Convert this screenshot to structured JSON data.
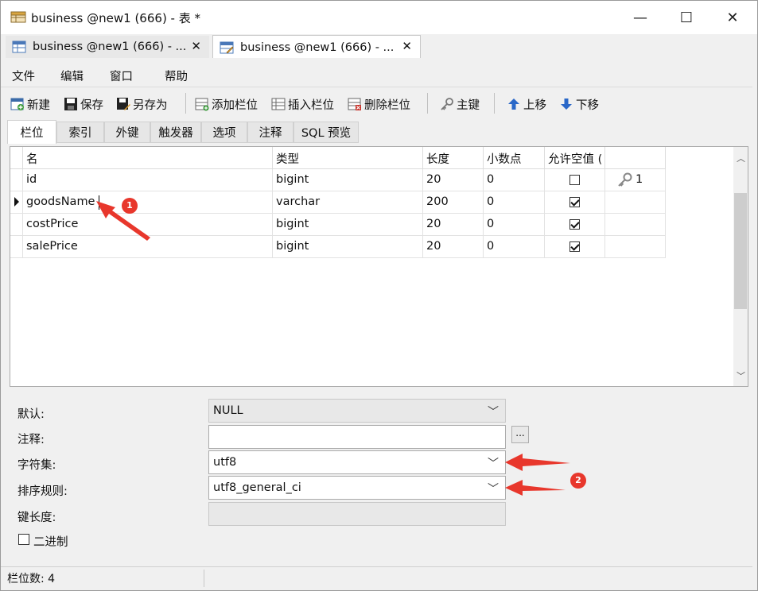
{
  "window": {
    "title": "business @new1 (666) - 表 *",
    "minimize_glyph": "—",
    "maximize_glyph": "☐",
    "close_glyph": "✕"
  },
  "doc_tabs": [
    {
      "label": "business @new1 (666) - ...",
      "close": "✕",
      "active": false
    },
    {
      "label": "business @new1 (666) - ...",
      "close": "✕",
      "active": true
    }
  ],
  "menu": [
    "文件",
    "编辑",
    "窗口",
    "帮助"
  ],
  "toolbar": {
    "new": "新建",
    "save": "保存",
    "save_as": "另存为",
    "add_field": "添加栏位",
    "insert_field": "插入栏位",
    "delete_field": "删除栏位",
    "primary_key": "主键",
    "move_up": "上移",
    "move_down": "下移"
  },
  "sub_tabs": [
    "栏位",
    "索引",
    "外键",
    "触发器",
    "选项",
    "注释",
    "SQL 预览"
  ],
  "grid": {
    "headers": [
      "名",
      "类型",
      "长度",
      "小数点",
      "允许空值 (",
      ""
    ],
    "rows": [
      {
        "name": "id",
        "type": "bigint",
        "length": "20",
        "decimal": "0",
        "nullable": false,
        "key": "1",
        "current": false
      },
      {
        "name": "goodsName",
        "type": "varchar",
        "length": "200",
        "decimal": "0",
        "nullable": true,
        "key": "",
        "current": true
      },
      {
        "name": "costPrice",
        "type": "bigint",
        "length": "20",
        "decimal": "0",
        "nullable": true,
        "key": "",
        "current": false
      },
      {
        "name": "salePrice",
        "type": "bigint",
        "length": "20",
        "decimal": "0",
        "nullable": true,
        "key": "",
        "current": false
      }
    ]
  },
  "properties": {
    "default_label": "默认:",
    "default_value": "NULL",
    "comment_label": "注释:",
    "comment_value": "",
    "comment_btn": "...",
    "charset_label": "字符集:",
    "charset_value": "utf8",
    "collation_label": "排序规则:",
    "collation_value": "utf8_general_ci",
    "key_length_label": "键长度:",
    "key_length_value": "",
    "binary_label": "二进制",
    "binary_checked": false
  },
  "status": {
    "field_count": "栏位数: 4"
  },
  "annotations": {
    "badge1": "1",
    "badge2": "2",
    "color": "#e8372c"
  }
}
